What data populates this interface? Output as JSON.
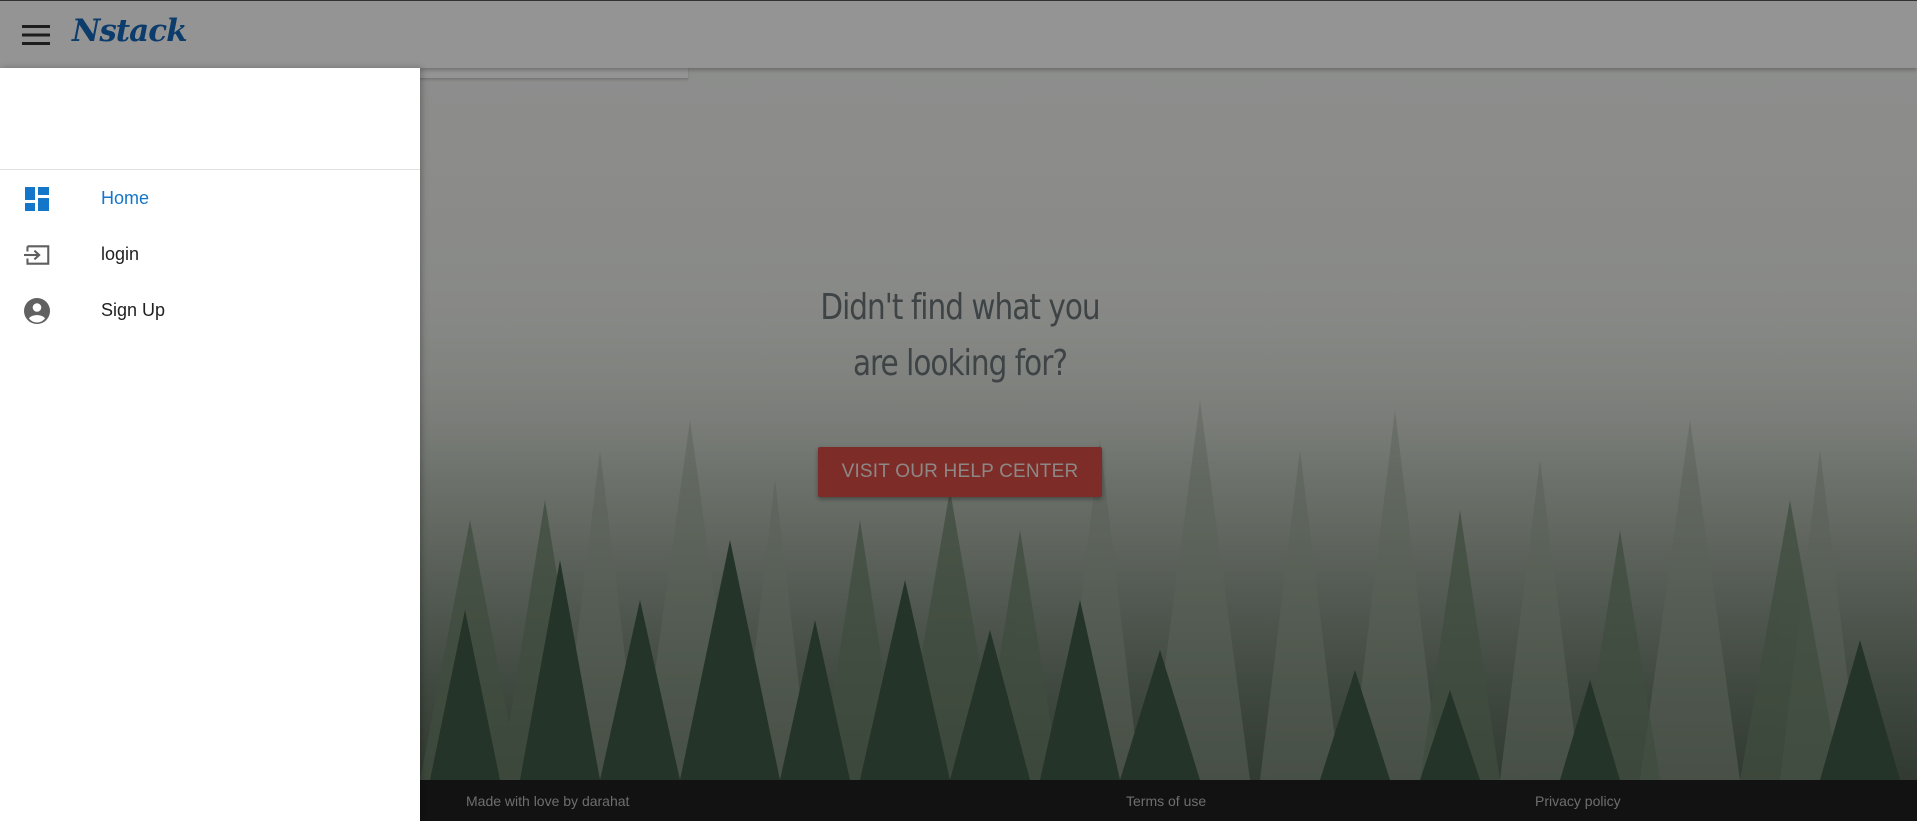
{
  "app_bar": {
    "brand": "Nstack",
    "menu_icon": "hamburger-menu-icon"
  },
  "drawer": {
    "items": [
      {
        "label": "Home",
        "icon": "dashboard-icon",
        "active": true
      },
      {
        "label": "login",
        "icon": "login-icon",
        "active": false
      },
      {
        "label": "Sign Up",
        "icon": "account-circle-icon",
        "active": false
      }
    ]
  },
  "hero": {
    "heading_line1": "Didn't find what you",
    "heading_line2": "are looking for?",
    "button_label": "VISIT OUR HELP CENTER"
  },
  "footer": {
    "made_by": "Made with love by darahat",
    "terms": "Terms of use",
    "privacy": "Privacy policy"
  },
  "colors": {
    "accent": "#1476c8",
    "brand": "#1668b8",
    "help_button": "#d84c45",
    "footer_bg": "#1f1f1f",
    "scrim": "rgba(0,0,0,0.42)"
  }
}
